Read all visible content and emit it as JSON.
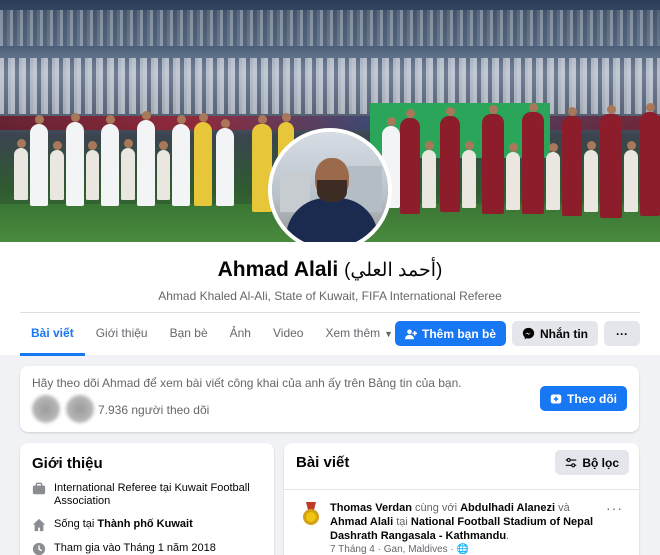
{
  "profile": {
    "name": "Ahmad Alali",
    "alternate_name": "(أحمد العلي)",
    "subtitle": "Ahmad Khaled Al-Ali, State of Kuwait, FIFA International Referee"
  },
  "tabs": [
    "Bài viết",
    "Giới thiệu",
    "Bạn bè",
    "Ảnh",
    "Video",
    "Xem thêm"
  ],
  "actions": {
    "add_friend": "Thêm bạn bè",
    "message": "Nhắn tin",
    "more": "···"
  },
  "follow_prompt": {
    "text": "Hãy theo dõi Ahmad để xem bài viết công khai của anh ấy trên Bảng tin của bạn.",
    "followers": "7.936 người theo dõi",
    "follow_button": "Theo dõi"
  },
  "intro": {
    "title": "Giới thiệu",
    "rows": [
      {
        "icon": "briefcase-icon",
        "text": "International Referee tại Kuwait Football Association"
      },
      {
        "icon": "home-icon",
        "prefix": "Sống tại ",
        "bold": "Thành phố Kuwait"
      },
      {
        "icon": "clock-icon",
        "text": "Tham gia vào Tháng 1 năm 2018"
      }
    ]
  },
  "posts": {
    "title": "Bài viết",
    "filter_label": "Bộ lọc",
    "post": {
      "author": "Thomas Verdan",
      "with_text": " cùng với ",
      "tagged1": "Abdulhadi Alanezi",
      "and_text": " và ",
      "tagged2": "Ahmad Alali",
      "at_text": " tại ",
      "place": "National Football Stadium of Nepal Dashrath Rangasala - Kathmandu",
      "period": ".",
      "meta": "7 Tháng 4 · Gan, Maldives · 🌐"
    }
  },
  "colors": {
    "accent": "#1877f2",
    "background": "#f0f2f5"
  }
}
